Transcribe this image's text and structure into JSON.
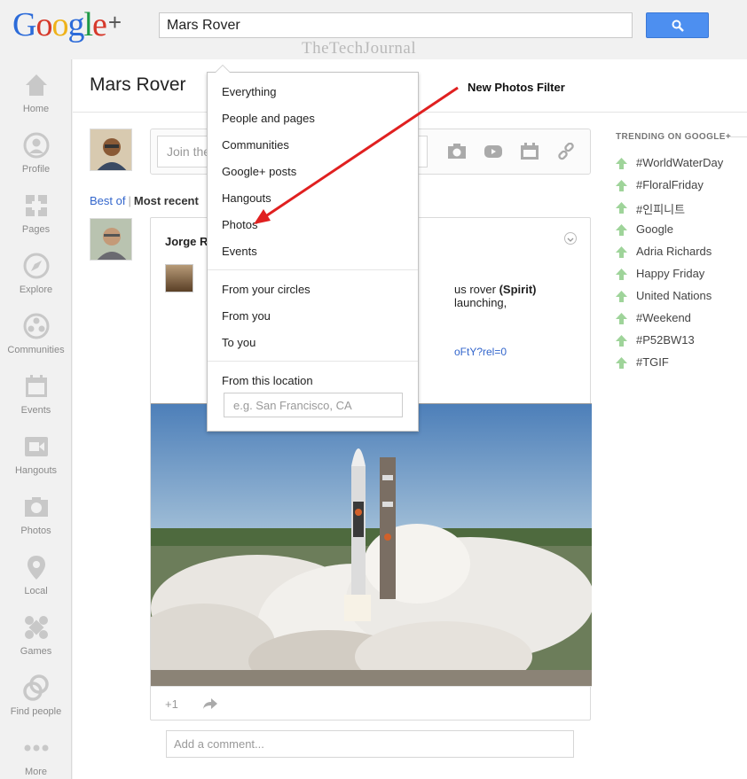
{
  "header": {
    "logo_text": "Google",
    "logo_plus": "+",
    "search_value": "Mars Rover",
    "watermark": "TheTechJournal"
  },
  "nav": [
    {
      "label": "Home",
      "icon": "home-icon"
    },
    {
      "label": "Profile",
      "icon": "profile-icon"
    },
    {
      "label": "Pages",
      "icon": "pages-icon"
    },
    {
      "label": "Explore",
      "icon": "compass-icon"
    },
    {
      "label": "Communities",
      "icon": "communities-icon"
    },
    {
      "label": "Events",
      "icon": "calendar-icon"
    },
    {
      "label": "Hangouts",
      "icon": "video-camera-icon"
    },
    {
      "label": "Photos",
      "icon": "camera-icon"
    },
    {
      "label": "Local",
      "icon": "map-pin-icon"
    },
    {
      "label": "Games",
      "icon": "games-icon"
    },
    {
      "label": "Find people",
      "icon": "find-people-icon"
    },
    {
      "label": "More",
      "icon": "more-dots-icon"
    }
  ],
  "main": {
    "title": "Mars Rover",
    "share_placeholder": "Join the",
    "filter_best": "Best of",
    "filter_sep": "|",
    "filter_recent": "Most recent"
  },
  "post": {
    "author": "Jorge R",
    "line1_frag": "us rover",
    "line1_bold": "(Spirit)",
    "line1_end": "launching,",
    "link_frag": "oFtY?rel=0",
    "plus_one": "+1",
    "comment_placeholder": "Add a comment..."
  },
  "trending": {
    "heading": "TRENDING ON GOOGLE+",
    "items": [
      "#WorldWaterDay",
      "#FloralFriday",
      "#인피니트",
      "Google",
      "Adria Richards",
      "Happy Friday",
      "United Nations",
      "#Weekend",
      "#P52BW13",
      "#TGIF"
    ]
  },
  "dropdown": {
    "types": [
      "Everything",
      "People and pages",
      "Communities",
      "Google+ posts",
      "Hangouts",
      "Photos",
      "Events"
    ],
    "sources": [
      "From your circles",
      "From you",
      "To you"
    ],
    "location_label": "From this location",
    "location_placeholder": "e.g. San Francisco, CA"
  },
  "annotation": {
    "label": "New Photos Filter",
    "color": "#e02020"
  },
  "colors": {
    "search_button": "#4d8ff0",
    "link": "#3366cc",
    "trend_arrow": "#9fd49a"
  }
}
